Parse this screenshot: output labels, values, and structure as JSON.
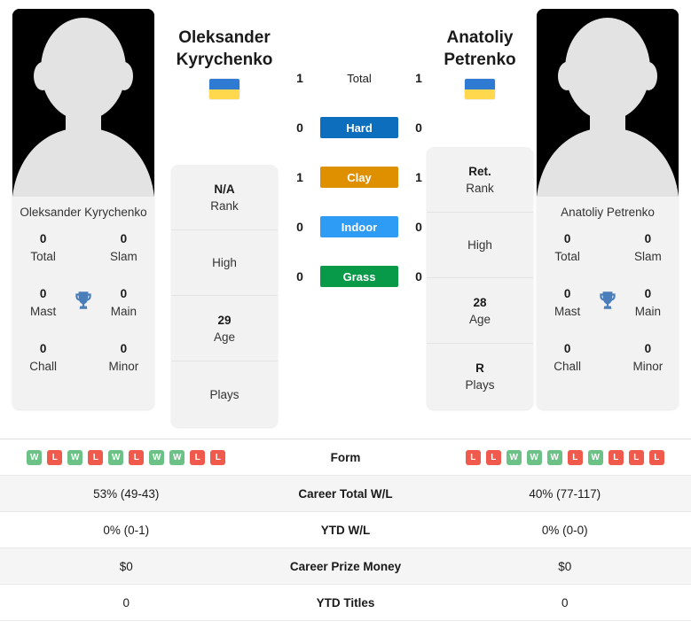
{
  "players": {
    "left": {
      "first_name": "Oleksander",
      "last_name": "Kyrychenko",
      "full_name": "Oleksander Kyrychenko",
      "flag": "ukraine-flag",
      "titles": [
        {
          "value": "0",
          "label": "Total"
        },
        {
          "value": "0",
          "label": "Slam"
        },
        {
          "value": "0",
          "label": "Mast"
        },
        {
          "value": "0",
          "label": "Main"
        },
        {
          "value": "0",
          "label": "Chall"
        },
        {
          "value": "0",
          "label": "Minor"
        }
      ],
      "info": [
        {
          "value": "N/A",
          "label": "Rank"
        },
        {
          "value": "",
          "label": "High"
        },
        {
          "value": "29",
          "label": "Age"
        },
        {
          "value": "",
          "label": "Plays"
        }
      ],
      "form": [
        "W",
        "L",
        "W",
        "L",
        "W",
        "L",
        "W",
        "W",
        "L",
        "L"
      ],
      "career_total_wl": "53% (49-43)",
      "ytd_wl": "0% (0-1)",
      "career_prize_money": "$0",
      "ytd_titles": "0"
    },
    "right": {
      "first_name": "Anatoliy",
      "last_name": "Petrenko",
      "full_name": "Anatoliy Petrenko",
      "flag": "ukraine-flag",
      "titles": [
        {
          "value": "0",
          "label": "Total"
        },
        {
          "value": "0",
          "label": "Slam"
        },
        {
          "value": "0",
          "label": "Mast"
        },
        {
          "value": "0",
          "label": "Main"
        },
        {
          "value": "0",
          "label": "Chall"
        },
        {
          "value": "0",
          "label": "Minor"
        }
      ],
      "info": [
        {
          "value": "Ret.",
          "label": "Rank"
        },
        {
          "value": "",
          "label": "High"
        },
        {
          "value": "28",
          "label": "Age"
        },
        {
          "value": "R",
          "label": "Plays"
        }
      ],
      "form": [
        "L",
        "L",
        "W",
        "W",
        "W",
        "L",
        "W",
        "L",
        "L",
        "L"
      ],
      "career_total_wl": "40% (77-117)",
      "ytd_wl": "0% (0-0)",
      "career_prize_money": "$0",
      "ytd_titles": "0"
    }
  },
  "head_to_head": [
    {
      "label": "Total",
      "left": "1",
      "right": "1",
      "color": "",
      "style": "plain"
    },
    {
      "label": "Hard",
      "left": "0",
      "right": "0",
      "color": "#0d6ebd",
      "style": "bar"
    },
    {
      "label": "Clay",
      "left": "1",
      "right": "1",
      "color": "#df9000",
      "style": "bar"
    },
    {
      "label": "Indoor",
      "left": "0",
      "right": "0",
      "color": "#2e9bf5",
      "style": "bar"
    },
    {
      "label": "Grass",
      "left": "0",
      "right": "0",
      "color": "#089949",
      "style": "bar"
    }
  ],
  "comparison_rows": [
    {
      "label": "Form",
      "type": "form",
      "left": "",
      "right": ""
    },
    {
      "label": "Career Total W/L",
      "type": "text",
      "left": "53% (49-43)",
      "right": "40% (77-117)"
    },
    {
      "label": "YTD W/L",
      "type": "text",
      "left": "0% (0-1)",
      "right": "0% (0-0)"
    },
    {
      "label": "Career Prize Money",
      "type": "text",
      "left": "$0",
      "right": "$0"
    },
    {
      "label": "YTD Titles",
      "type": "text",
      "left": "0",
      "right": "0"
    }
  ],
  "icons": {
    "trophy": "trophy-icon",
    "avatar": "avatar-silhouette-icon"
  },
  "colors": {
    "trophy": "#4a7ebb",
    "win_badge": "#6cc286",
    "loss_badge": "#ef5a4c",
    "card_bg": "#f2f2f2",
    "flag_blue": "#2F7BD4",
    "flag_yellow": "#FFD84D"
  }
}
